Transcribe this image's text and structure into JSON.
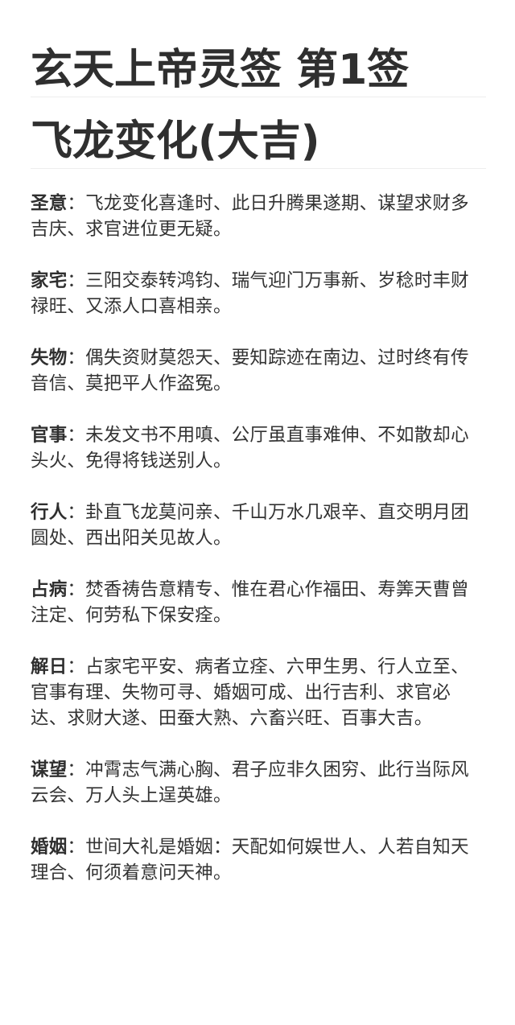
{
  "title": "玄天上帝灵签 第1签",
  "subtitle": "飞龙变化(大吉)",
  "separator": "：",
  "entries": [
    {
      "label": "圣意",
      "text": "飞龙变化喜逢时、此日升腾果遂期、谋望求财多吉庆、求官进位更无疑。"
    },
    {
      "label": "家宅",
      "text": "三阳交泰转鸿钧、瑞气迎门万事新、岁稔时丰财禄旺、又添人口喜相亲。"
    },
    {
      "label": "失物",
      "text": "偶失资财莫怨天、要知踪迹在南边、过时终有传音信、莫把平人作盗冤。"
    },
    {
      "label": "官事",
      "text": "未发文书不用嗔、公厅虽直事难伸、不如散却心头火、免得将钱送别人。"
    },
    {
      "label": "行人",
      "text": "卦直飞龙莫问亲、千山万水几艰辛、直交明月团圆处、西出阳关见故人。"
    },
    {
      "label": "占病",
      "text": "焚香祷告意精专、惟在君心作福田、寿筭天曹曾注定、何劳私下保安痊。"
    },
    {
      "label": "解日",
      "text": "占家宅平安、病者立痊、六甲生男、行人立至、官事有理、失物可寻、婚姻可成、出行吉利、求官必达、求财大遂、田蚕大熟、六畜兴旺、百事大吉。"
    },
    {
      "label": "谋望",
      "text": "冲霄志气满心胸、君子应非久困穷、此行当际风云会、万人头上逞英雄。"
    },
    {
      "label": "婚姻",
      "text": "世间大礼是婚姻：天配如何娱世人、人若自知天理合、何须着意问天神。"
    }
  ]
}
